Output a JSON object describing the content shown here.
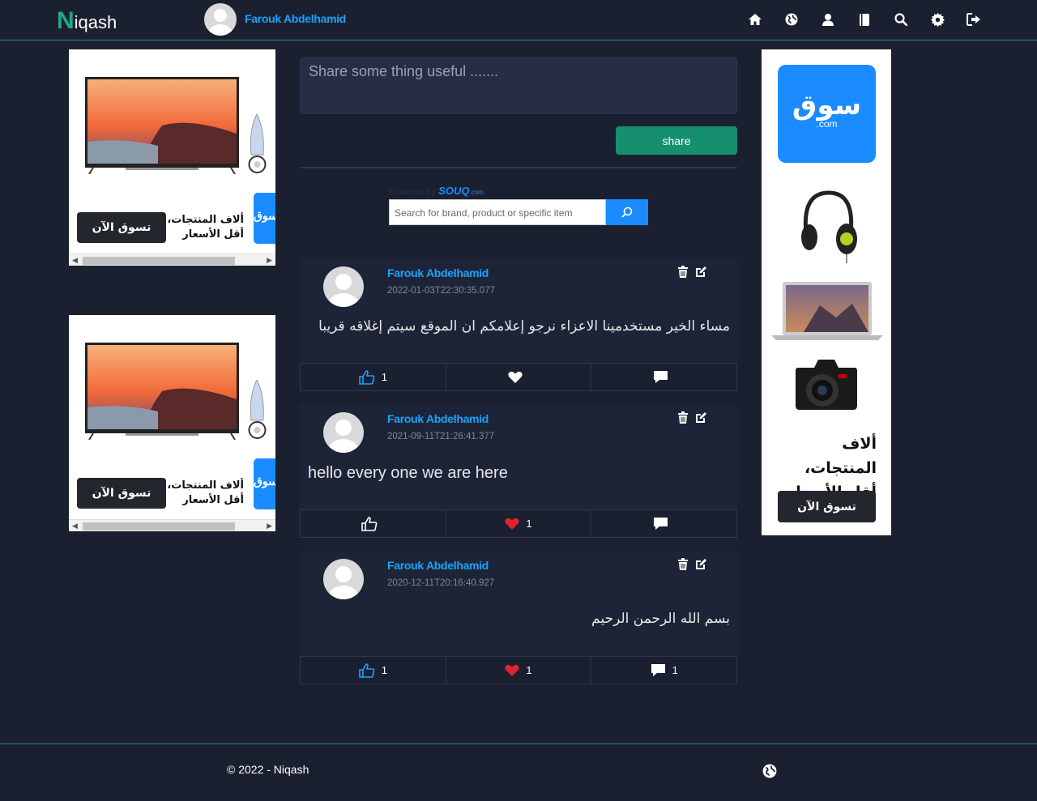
{
  "header": {
    "logo_initial": "N",
    "logo_rest": "iqash",
    "user_name": "Farouk Abdelhamid",
    "nav_icons": [
      "home-icon",
      "globe-icon",
      "user-icon",
      "book-icon",
      "search-icon",
      "gear-icon",
      "sign-out-icon"
    ]
  },
  "ads": {
    "left_text_line1": "ألاف المنتجات،",
    "left_text_line2": "أقل الأسعار",
    "left_button": "تسوق الآن",
    "left_tab": "سوق",
    "right_logo_ar": "سوق",
    "right_logo_en": ".com",
    "right_text_line1": "ألاف المنتجات،",
    "right_text_line2": "أقل الأسعار",
    "right_button": "تسوق الآن"
  },
  "composer": {
    "placeholder": "Share some thing useful .......",
    "share_label": "share"
  },
  "souq_widget": {
    "powered_by": "Powered by",
    "brand": "SOUQ",
    "brand_suffix": ".com",
    "placeholder": "Search for brand, product or specific item"
  },
  "posts": [
    {
      "author": "Farouk Abdelhamid",
      "date": "2022-01-03T22:30:35.077",
      "text": "مساء الخير مستخدمينا الاعزاء نرجو إعلامكم ان الموقع سيتم إغلاقه قريبا",
      "likes": "1",
      "hearts": "",
      "comments": ""
    },
    {
      "author": "Farouk Abdelhamid",
      "date": "2021-09-11T21:26:41.377",
      "text": "hello every one we are here",
      "likes": "",
      "hearts": "1",
      "comments": ""
    },
    {
      "author": "Farouk Abdelhamid",
      "date": "2020-12-11T20:16:40.927",
      "text": "بسم الله الرحمن الرحيم",
      "likes": "1",
      "hearts": "1",
      "comments": "1"
    }
  ],
  "footer": {
    "copyright": "© 2022 - Niqash"
  },
  "colors": {
    "background": "#1b2030",
    "accent": "#1ea886",
    "link": "#1aa3ff",
    "share_button": "#168f6f",
    "heart_active": "#e0212e"
  }
}
